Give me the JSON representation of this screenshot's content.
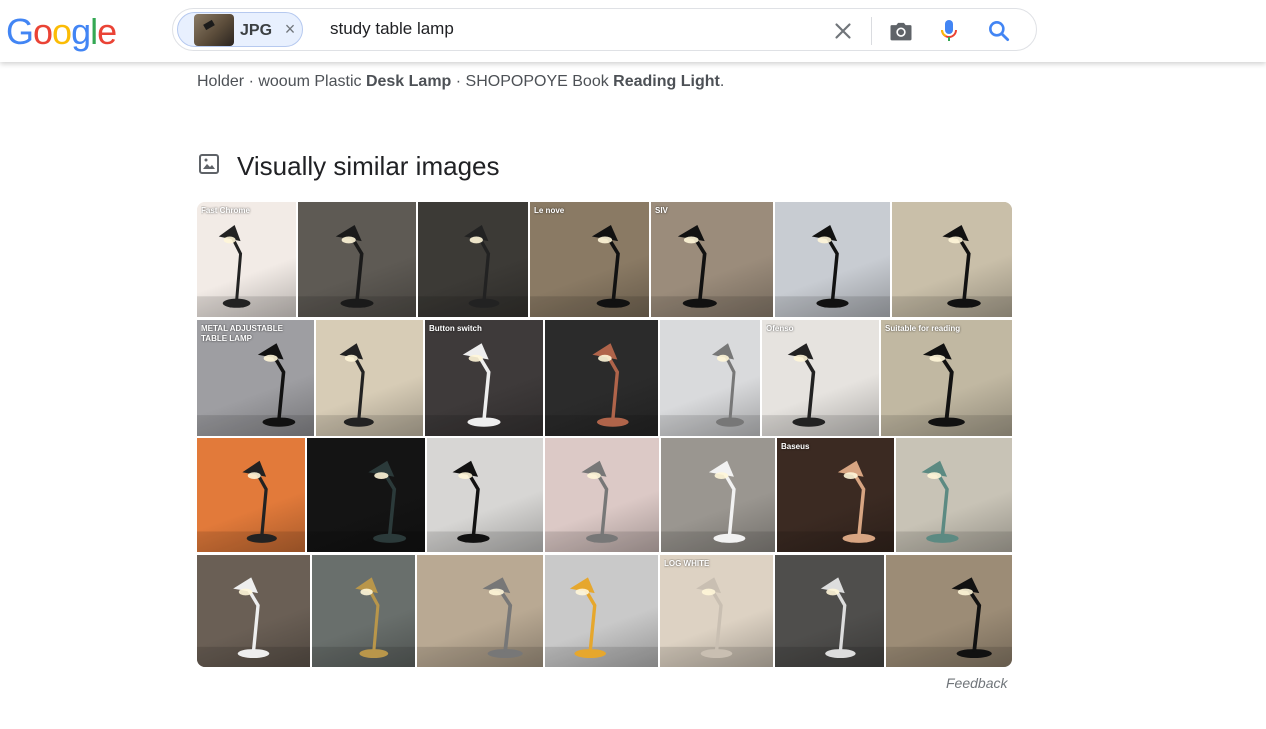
{
  "logo": {
    "letters": [
      "G",
      "o",
      "o",
      "g",
      "l",
      "e"
    ],
    "colors": [
      "#4285F4",
      "#EA4335",
      "#FBBC05",
      "#4285F4",
      "#34A853",
      "#EA4335"
    ]
  },
  "search": {
    "chip_label": "JPG",
    "chip_close": "×",
    "query": "study table lamp",
    "clear_icon": "close-icon",
    "camera_icon": "camera-icon",
    "mic_icon": "mic-icon",
    "search_icon": "search-icon"
  },
  "snippet": {
    "part1": "Holder · wooum Plastic ",
    "bold1": "Desk Lamp",
    "part2": " · SHOPOPOYE Book ",
    "bold2": "Reading Light",
    "part3": "."
  },
  "visually_similar": {
    "title": "Visually similar images",
    "icon": "image-icon"
  },
  "thumbnails": [
    {
      "bg": "#f2ebe6",
      "lamp": "#222",
      "overlay": "Fast Chrome"
    },
    {
      "bg": "#5e5a54",
      "lamp": "#1a1a1a",
      "overlay": ""
    },
    {
      "bg": "#3c3a36",
      "lamp": "#222",
      "overlay": ""
    },
    {
      "bg": "#8a7a64",
      "lamp": "#111",
      "overlay": "Le nove"
    },
    {
      "bg": "#9b8c7b",
      "lamp": "#111",
      "overlay": "SIV"
    },
    {
      "bg": "#c8ccd2",
      "lamp": "#111",
      "overlay": ""
    },
    {
      "bg": "#c9bfa9",
      "lamp": "#111",
      "overlay": ""
    },
    {
      "bg": "#9e9ea2",
      "lamp": "#111",
      "overlay": "METAL ADJUSTABLE TABLE LAMP"
    },
    {
      "bg": "#d7ccb6",
      "lamp": "#222",
      "overlay": ""
    },
    {
      "bg": "#3e3a3a",
      "lamp": "#eee",
      "overlay": "Button switch"
    },
    {
      "bg": "#2b2b2b",
      "lamp": "#b0644a",
      "overlay": ""
    },
    {
      "bg": "#d9dadc",
      "lamp": "#777",
      "overlay": ""
    },
    {
      "bg": "#e6e3df",
      "lamp": "#222",
      "overlay": "Ofenso"
    },
    {
      "bg": "#c1b8a2",
      "lamp": "#111",
      "overlay": "Suitable for reading"
    },
    {
      "bg": "#e27a3a",
      "lamp": "#222",
      "overlay": ""
    },
    {
      "bg": "#141414",
      "lamp": "#2b3a3a",
      "overlay": ""
    },
    {
      "bg": "#d7d6d4",
      "lamp": "#111",
      "overlay": ""
    },
    {
      "bg": "#dcc9c6",
      "lamp": "#777",
      "overlay": ""
    },
    {
      "bg": "#9a9690",
      "lamp": "#f2f2f2",
      "overlay": ""
    },
    {
      "bg": "#3b2a22",
      "lamp": "#d8a582",
      "overlay": "Baseus"
    },
    {
      "bg": "#c8c3b6",
      "lamp": "#5c8a82",
      "overlay": ""
    },
    {
      "bg": "#6a5f55",
      "lamp": "#eee",
      "overlay": ""
    },
    {
      "bg": "#696f6c",
      "lamp": "#b9964a",
      "overlay": ""
    },
    {
      "bg": "#b9a993",
      "lamp": "#777",
      "overlay": ""
    },
    {
      "bg": "#c9c9c9",
      "lamp": "#e6a72d",
      "overlay": ""
    },
    {
      "bg": "#ddd2c3",
      "lamp": "#c9bfb2",
      "overlay": "LOG WHITE"
    },
    {
      "bg": "#4f4e4c",
      "lamp": "#ddd",
      "overlay": ""
    },
    {
      "bg": "#9c8c76",
      "lamp": "#111",
      "overlay": ""
    }
  ],
  "feedback": "Feedback"
}
